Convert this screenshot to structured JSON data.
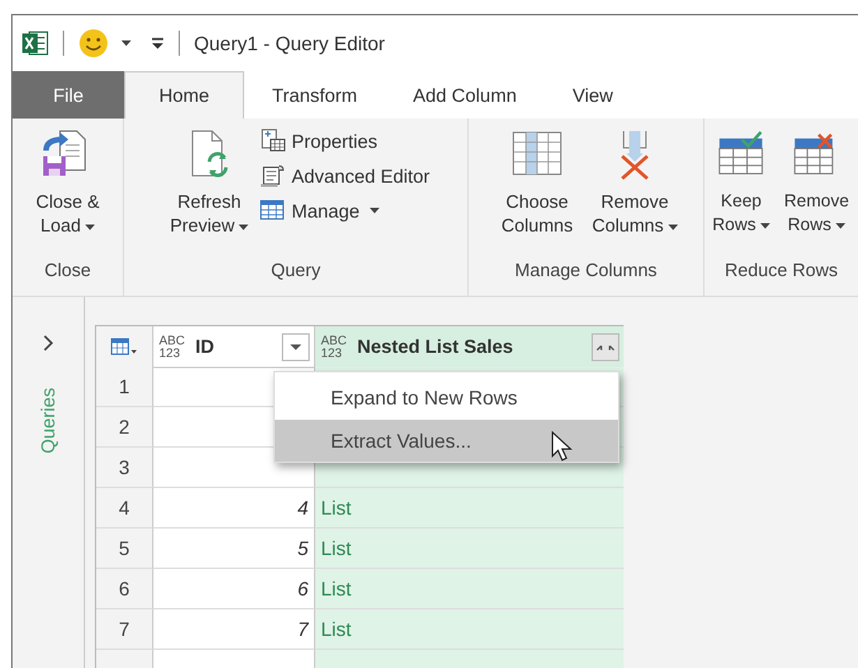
{
  "title_bar": {
    "title": "Query1 - Query Editor"
  },
  "tabs": [
    {
      "label": "File",
      "kind": "file",
      "selected": false
    },
    {
      "label": "Home",
      "kind": "tab",
      "selected": true
    },
    {
      "label": "Transform",
      "kind": "tab",
      "selected": false
    },
    {
      "label": "Add Column",
      "kind": "tab",
      "selected": false
    },
    {
      "label": "View",
      "kind": "tab",
      "selected": false
    }
  ],
  "ribbon": {
    "groups": [
      {
        "label": "Close",
        "buttons": [
          {
            "kind": "large",
            "label": "Close & Load",
            "dropdown": true
          }
        ]
      },
      {
        "label": "Query",
        "buttons": [
          {
            "kind": "large",
            "label": "Refresh Preview",
            "dropdown": true
          },
          {
            "kind": "small",
            "label": "Properties",
            "dropdown": false
          },
          {
            "kind": "small",
            "label": "Advanced Editor",
            "dropdown": false
          },
          {
            "kind": "small",
            "label": "Manage",
            "dropdown": true
          }
        ]
      },
      {
        "label": "Manage Columns",
        "buttons": [
          {
            "kind": "large",
            "label": "Choose Columns",
            "dropdown": false
          },
          {
            "kind": "large",
            "label": "Remove Columns",
            "dropdown": true
          }
        ]
      },
      {
        "label": "Reduce Rows",
        "buttons": [
          {
            "kind": "large",
            "label": "Keep Rows",
            "dropdown": true
          },
          {
            "kind": "large",
            "label": "Remove Rows",
            "dropdown": true
          }
        ]
      }
    ]
  },
  "queries_pane": {
    "label": "Queries",
    "expanded": false
  },
  "table": {
    "columns": [
      {
        "type": "ABC 123",
        "name": "ID",
        "selected": false
      },
      {
        "type": "ABC 123",
        "name": "Nested List Sales",
        "selected": true
      }
    ],
    "rows": [
      {
        "number": "1"
      },
      {
        "number": "2"
      },
      {
        "number": "3"
      },
      {
        "number": "4",
        "id": "4",
        "value": "List"
      },
      {
        "number": "5",
        "id": "5",
        "value": "List"
      },
      {
        "number": "6",
        "id": "6",
        "value": "List"
      },
      {
        "number": "7",
        "id": "7",
        "value": "List"
      }
    ]
  },
  "context_menu": {
    "items": [
      {
        "label": "Expand to New Rows",
        "selected": false
      },
      {
        "label": "Extract Values...",
        "selected": true
      }
    ]
  }
}
